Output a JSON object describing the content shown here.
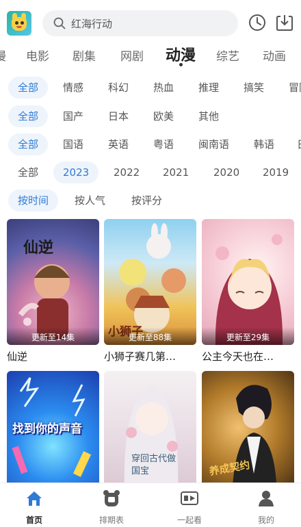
{
  "search": {
    "query": "红海行动"
  },
  "header_icons": [
    "history-clock-icon",
    "download-icon"
  ],
  "main_nav": {
    "items": [
      "漫",
      "电影",
      "剧集",
      "网剧",
      "动漫",
      "综艺",
      "动画"
    ],
    "active_index": 4
  },
  "filters": {
    "genre": [
      "全部",
      "情感",
      "科幻",
      "热血",
      "推理",
      "搞笑",
      "冒险"
    ],
    "region": [
      "全部",
      "国产",
      "日本",
      "欧美",
      "其他"
    ],
    "language": [
      "全部",
      "国语",
      "英语",
      "粤语",
      "闽南语",
      "韩语",
      "日语"
    ],
    "year": [
      "全部",
      "2023",
      "2022",
      "2021",
      "2020",
      "2019"
    ],
    "sort": [
      "按时间",
      "按人气",
      "按评分"
    ]
  },
  "cards": [
    {
      "title": "仙逆",
      "update": "更新至14集",
      "poster_text": "仙逆"
    },
    {
      "title": "小狮子赛几第…",
      "update": "更新至88集",
      "poster_text": "小狮子"
    },
    {
      "title": "公主今天也在…",
      "update": "更新至29集",
      "poster_text": ""
    },
    {
      "title": "",
      "update": "",
      "poster_text": "找到你的声音"
    },
    {
      "title": "",
      "update": "",
      "poster_text": "穿回古代做国宝"
    },
    {
      "title": "",
      "update": "",
      "poster_text": "养成契约"
    }
  ],
  "tabbar": {
    "items": [
      {
        "label": "首页",
        "icon": "home-icon"
      },
      {
        "label": "排期表",
        "icon": "schedule-bear-icon"
      },
      {
        "label": "一起看",
        "icon": "watch-together-icon"
      },
      {
        "label": "我的",
        "icon": "profile-icon"
      }
    ],
    "active_index": 0
  },
  "colors": {
    "accent": "#2f7ad6",
    "chip_bg": "#eef4fb",
    "tab_active": "#2f7ad6"
  }
}
